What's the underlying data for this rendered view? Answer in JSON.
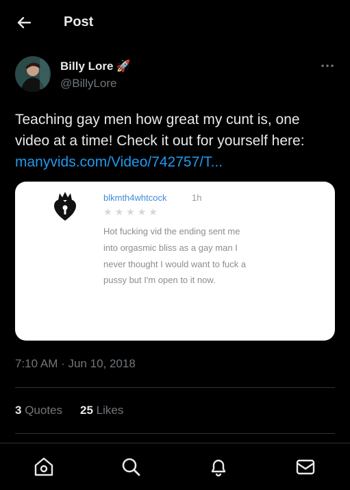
{
  "header": {
    "title": "Post"
  },
  "author": {
    "name": "Billy Lore",
    "handle": "@BillyLore",
    "emoji": "🚀"
  },
  "tweet": {
    "text": "Teaching gay men how great my cunt is, one video at a time! Check it out for yourself here: ",
    "link": "manyvids.com/Video/742757/T..."
  },
  "media": {
    "review_user": "blkmth4whtcock",
    "review_time": "1h",
    "review_text": "Hot fucking vid the ending sent me into orgasmic bliss as a gay man I never thought I would want to fuck a pussy but I'm open to it now."
  },
  "meta": {
    "timestamp": "7:10 AM · Jun 10, 2018"
  },
  "stats": {
    "quotes_count": "3",
    "quotes_label": "Quotes",
    "likes_count": "25",
    "likes_label": "Likes"
  },
  "nav": [
    "home-icon",
    "search-icon",
    "notifications-icon",
    "messages-icon"
  ],
  "colors": {
    "accent": "#1d9bf0",
    "background": "#000000",
    "secondary_text": "#71767b"
  }
}
